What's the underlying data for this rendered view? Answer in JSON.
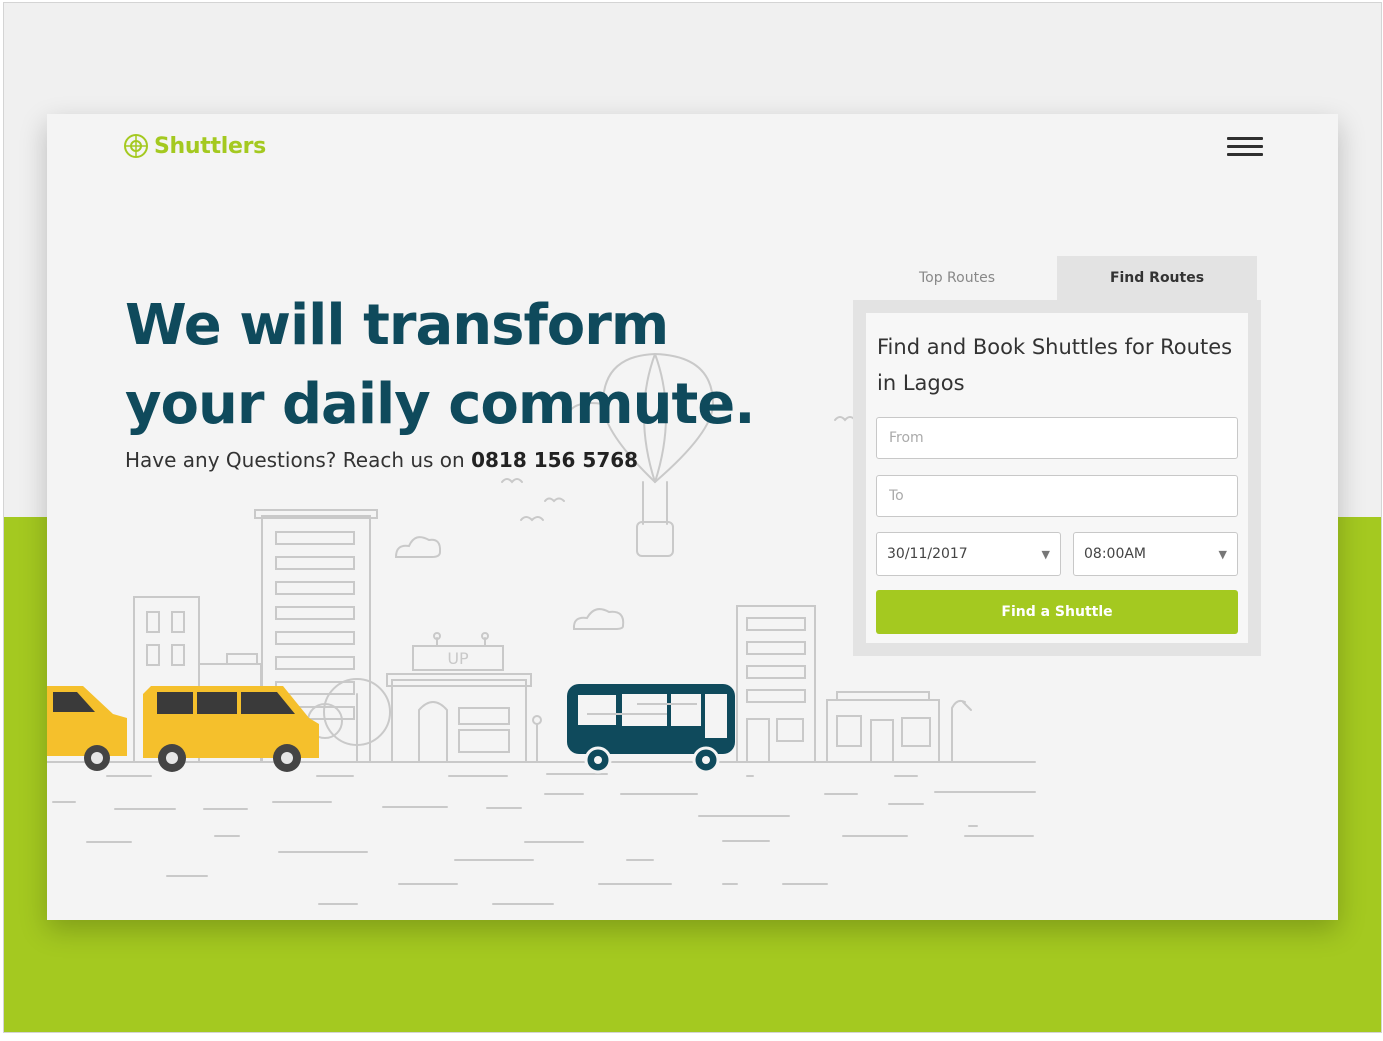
{
  "brand": {
    "name": "Shuttlers",
    "accent_color": "#a4c920",
    "heading_color": "#0f4a5c"
  },
  "header": {
    "menu_icon": "hamburger-menu-icon"
  },
  "hero": {
    "headline": "We will transform your daily commute.",
    "subline": "Have any Questions? Reach us on",
    "phone": "0818 156 5768"
  },
  "booking": {
    "tabs": [
      "Top Routes",
      "Find Routes"
    ],
    "active_tab": "Find Routes",
    "title": "Find and Book Shuttles for Routes in Lagos",
    "from_placeholder": "From",
    "to_placeholder": "To",
    "date_value": "30/11/2017",
    "time_value": "08:00AM",
    "submit_label": "Find a Shuttle"
  },
  "illustration": {
    "sign_text": "UP",
    "bus_color": "#0f4a5c",
    "car_color": "#f5c02c"
  }
}
